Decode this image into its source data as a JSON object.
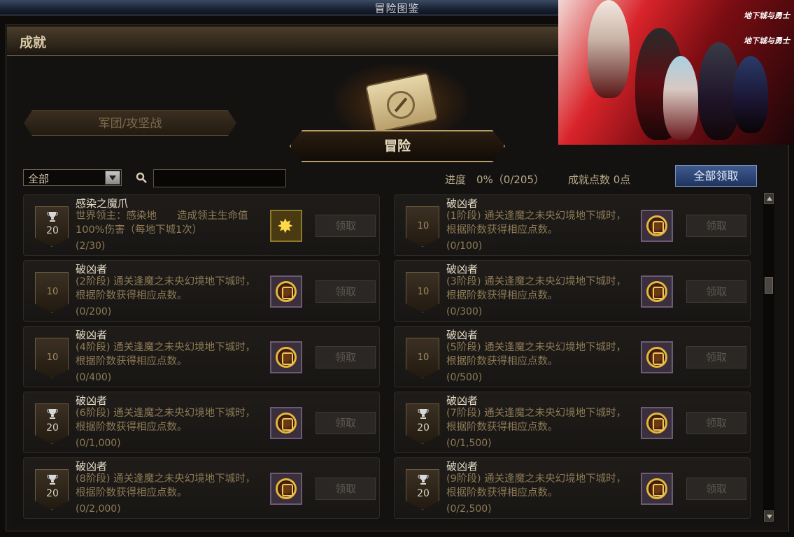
{
  "window": {
    "title": "冒险图鉴"
  },
  "section": {
    "title": "成就"
  },
  "categories": {
    "left": "军团/攻坚战",
    "main": "冒险"
  },
  "filter": {
    "selected": "全部",
    "search_value": ""
  },
  "status": {
    "progress": "进度　0%（0/205）",
    "points": "成就点数 0点"
  },
  "buttons": {
    "claim_all": "全部领取"
  },
  "promo": {
    "logo_top": "地下城与勇士",
    "logo_bottom": "地下城与勇士"
  },
  "achievements": [
    {
      "title": "感染之魔爪",
      "desc": "世界领主：感染地　　造成领主生命值100%伤害（每地下城1次）",
      "count": "(2/30)",
      "points": "20",
      "trophy": true,
      "reward": "gold",
      "claim": "领取"
    },
    {
      "title": "破凶者",
      "desc": "(1阶段) 通关逢魔之未央幻境地下城时，根据阶数获得相应点数。",
      "count": "(0/100)",
      "points": "10",
      "trophy": false,
      "reward": "emblem",
      "claim": "领取"
    },
    {
      "title": "破凶者",
      "desc": "(2阶段) 通关逢魔之未央幻境地下城时，根据阶数获得相应点数。",
      "count": "(0/200)",
      "points": "10",
      "trophy": false,
      "reward": "emblem",
      "claim": "领取"
    },
    {
      "title": "破凶者",
      "desc": "(3阶段) 通关逢魔之未央幻境地下城时，根据阶数获得相应点数。",
      "count": "(0/300)",
      "points": "10",
      "trophy": false,
      "reward": "emblem",
      "claim": "领取"
    },
    {
      "title": "破凶者",
      "desc": "(4阶段) 通关逢魔之未央幻境地下城时，根据阶数获得相应点数。",
      "count": "(0/400)",
      "points": "10",
      "trophy": false,
      "reward": "emblem",
      "claim": "领取"
    },
    {
      "title": "破凶者",
      "desc": "(5阶段) 通关逢魔之未央幻境地下城时，根据阶数获得相应点数。",
      "count": "(0/500)",
      "points": "10",
      "trophy": false,
      "reward": "emblem",
      "claim": "领取"
    },
    {
      "title": "破凶者",
      "desc": "(6阶段) 通关逢魔之未央幻境地下城时，根据阶数获得相应点数。",
      "count": "(0/1,000)",
      "points": "20",
      "trophy": true,
      "reward": "emblem",
      "claim": "领取"
    },
    {
      "title": "破凶者",
      "desc": "(7阶段) 通关逢魔之未央幻境地下城时，根据阶数获得相应点数。",
      "count": "(0/1,500)",
      "points": "20",
      "trophy": true,
      "reward": "emblem",
      "claim": "领取"
    },
    {
      "title": "破凶者",
      "desc": "(8阶段) 通关逢魔之未央幻境地下城时，根据阶数获得相应点数。",
      "count": "(0/2,000)",
      "points": "20",
      "trophy": true,
      "reward": "emblem",
      "claim": "领取"
    },
    {
      "title": "破凶者",
      "desc": "(9阶段) 通关逢魔之未央幻境地下城时，根据阶数获得相应点数。",
      "count": "(0/2,500)",
      "points": "20",
      "trophy": true,
      "reward": "emblem",
      "claim": "领取"
    }
  ]
}
